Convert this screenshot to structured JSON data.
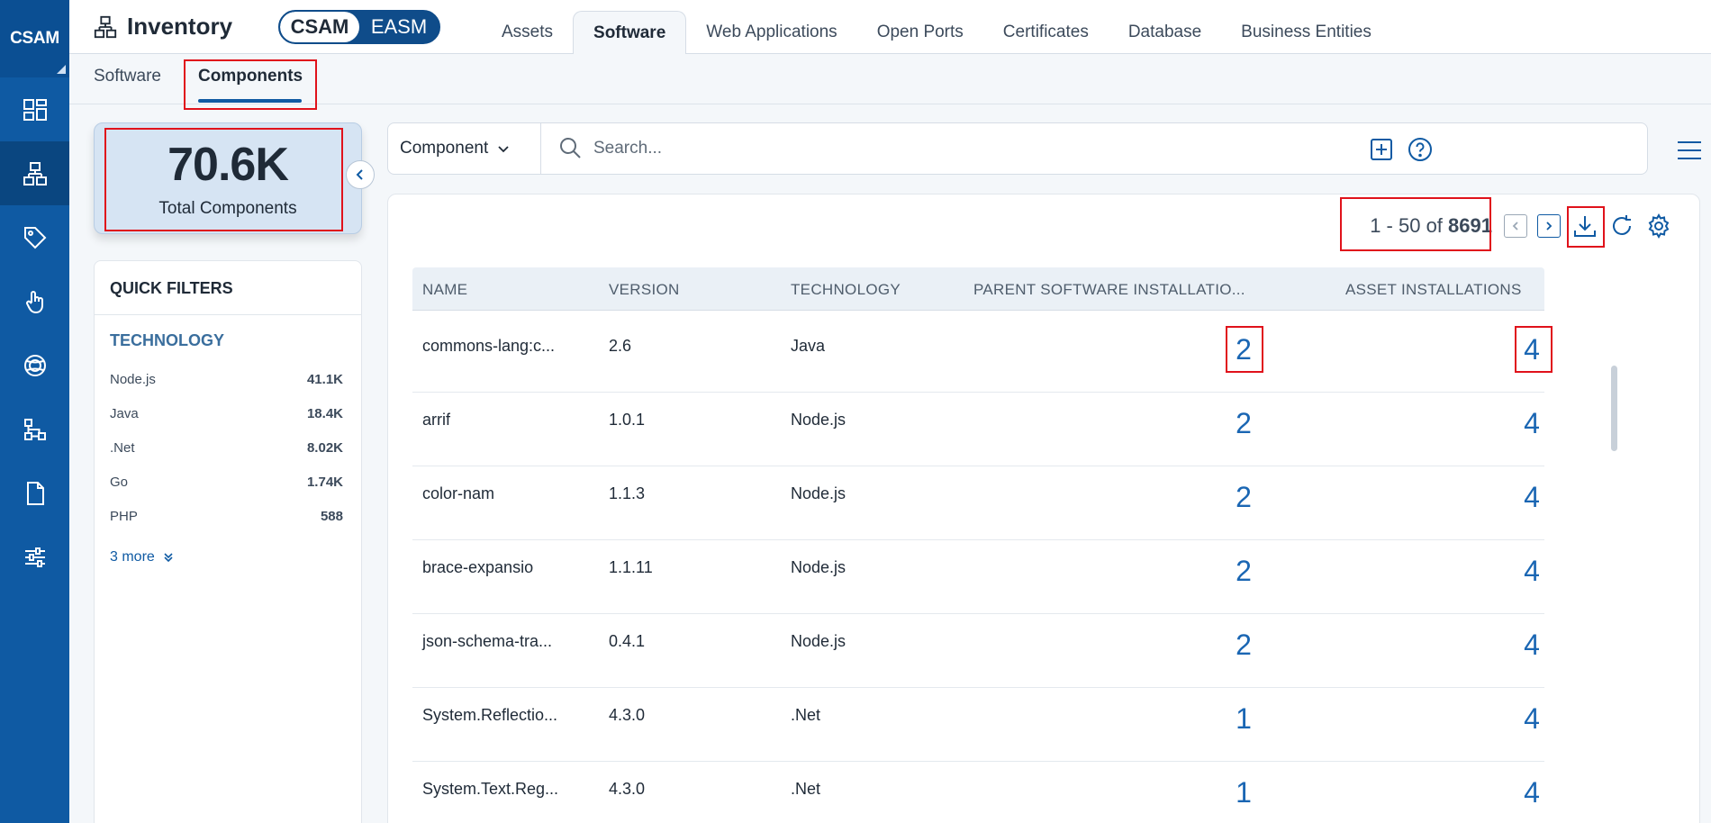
{
  "rail": {
    "brand": "CSAM",
    "items": [
      "dashboard-icon",
      "inventory-icon",
      "tag-icon",
      "touch-icon",
      "globe-icon",
      "network-icon",
      "document-icon",
      "sliders-icon"
    ]
  },
  "header": {
    "title": "Inventory",
    "toggle": {
      "left": "CSAM",
      "right": "EASM"
    },
    "tabs": [
      "Assets",
      "Software",
      "Web Applications",
      "Open Ports",
      "Certificates",
      "Database",
      "Business Entities"
    ],
    "active_tab": "Software"
  },
  "subtabs": [
    "Software",
    "Components"
  ],
  "stat": {
    "value": "70.6K",
    "label": "Total Components"
  },
  "quick_filters": {
    "title": "QUICK FILTERS",
    "section": "TECHNOLOGY",
    "items": [
      {
        "label": "Node.js",
        "count": "41.1K"
      },
      {
        "label": "Java",
        "count": "18.4K"
      },
      {
        "label": ".Net",
        "count": "8.02K"
      },
      {
        "label": "Go",
        "count": "1.74K"
      },
      {
        "label": "PHP",
        "count": "588"
      }
    ],
    "more": "3 more"
  },
  "search": {
    "scope": "Component",
    "placeholder": "Search..."
  },
  "pager": {
    "range": "1 - 50 of",
    "total": "8691"
  },
  "table": {
    "columns": [
      "NAME",
      "VERSION",
      "TECHNOLOGY",
      "PARENT SOFTWARE INSTALLATIO...",
      "ASSET INSTALLATIONS"
    ],
    "rows": [
      {
        "name": "commons-lang:c...",
        "version": "2.6",
        "technology": "Java",
        "parent": "2",
        "asset": "4"
      },
      {
        "name": "arrif",
        "version": "1.0.1",
        "technology": "Node.js",
        "parent": "2",
        "asset": "4"
      },
      {
        "name": "color-nam",
        "version": "1.1.3",
        "technology": "Node.js",
        "parent": "2",
        "asset": "4"
      },
      {
        "name": "brace-expansio",
        "version": "1.1.11",
        "technology": "Node.js",
        "parent": "2",
        "asset": "4"
      },
      {
        "name": "json-schema-tra...",
        "version": "0.4.1",
        "technology": "Node.js",
        "parent": "2",
        "asset": "4"
      },
      {
        "name": "System.Reflectio...",
        "version": "4.3.0",
        "technology": ".Net",
        "parent": "1",
        "asset": "4"
      },
      {
        "name": "System.Text.Reg...",
        "version": "4.3.0",
        "technology": ".Net",
        "parent": "1",
        "asset": "4"
      }
    ]
  },
  "colors": {
    "rail": "#0f5aa3",
    "accent": "#1a66b3",
    "highlight": "#e0121b"
  }
}
